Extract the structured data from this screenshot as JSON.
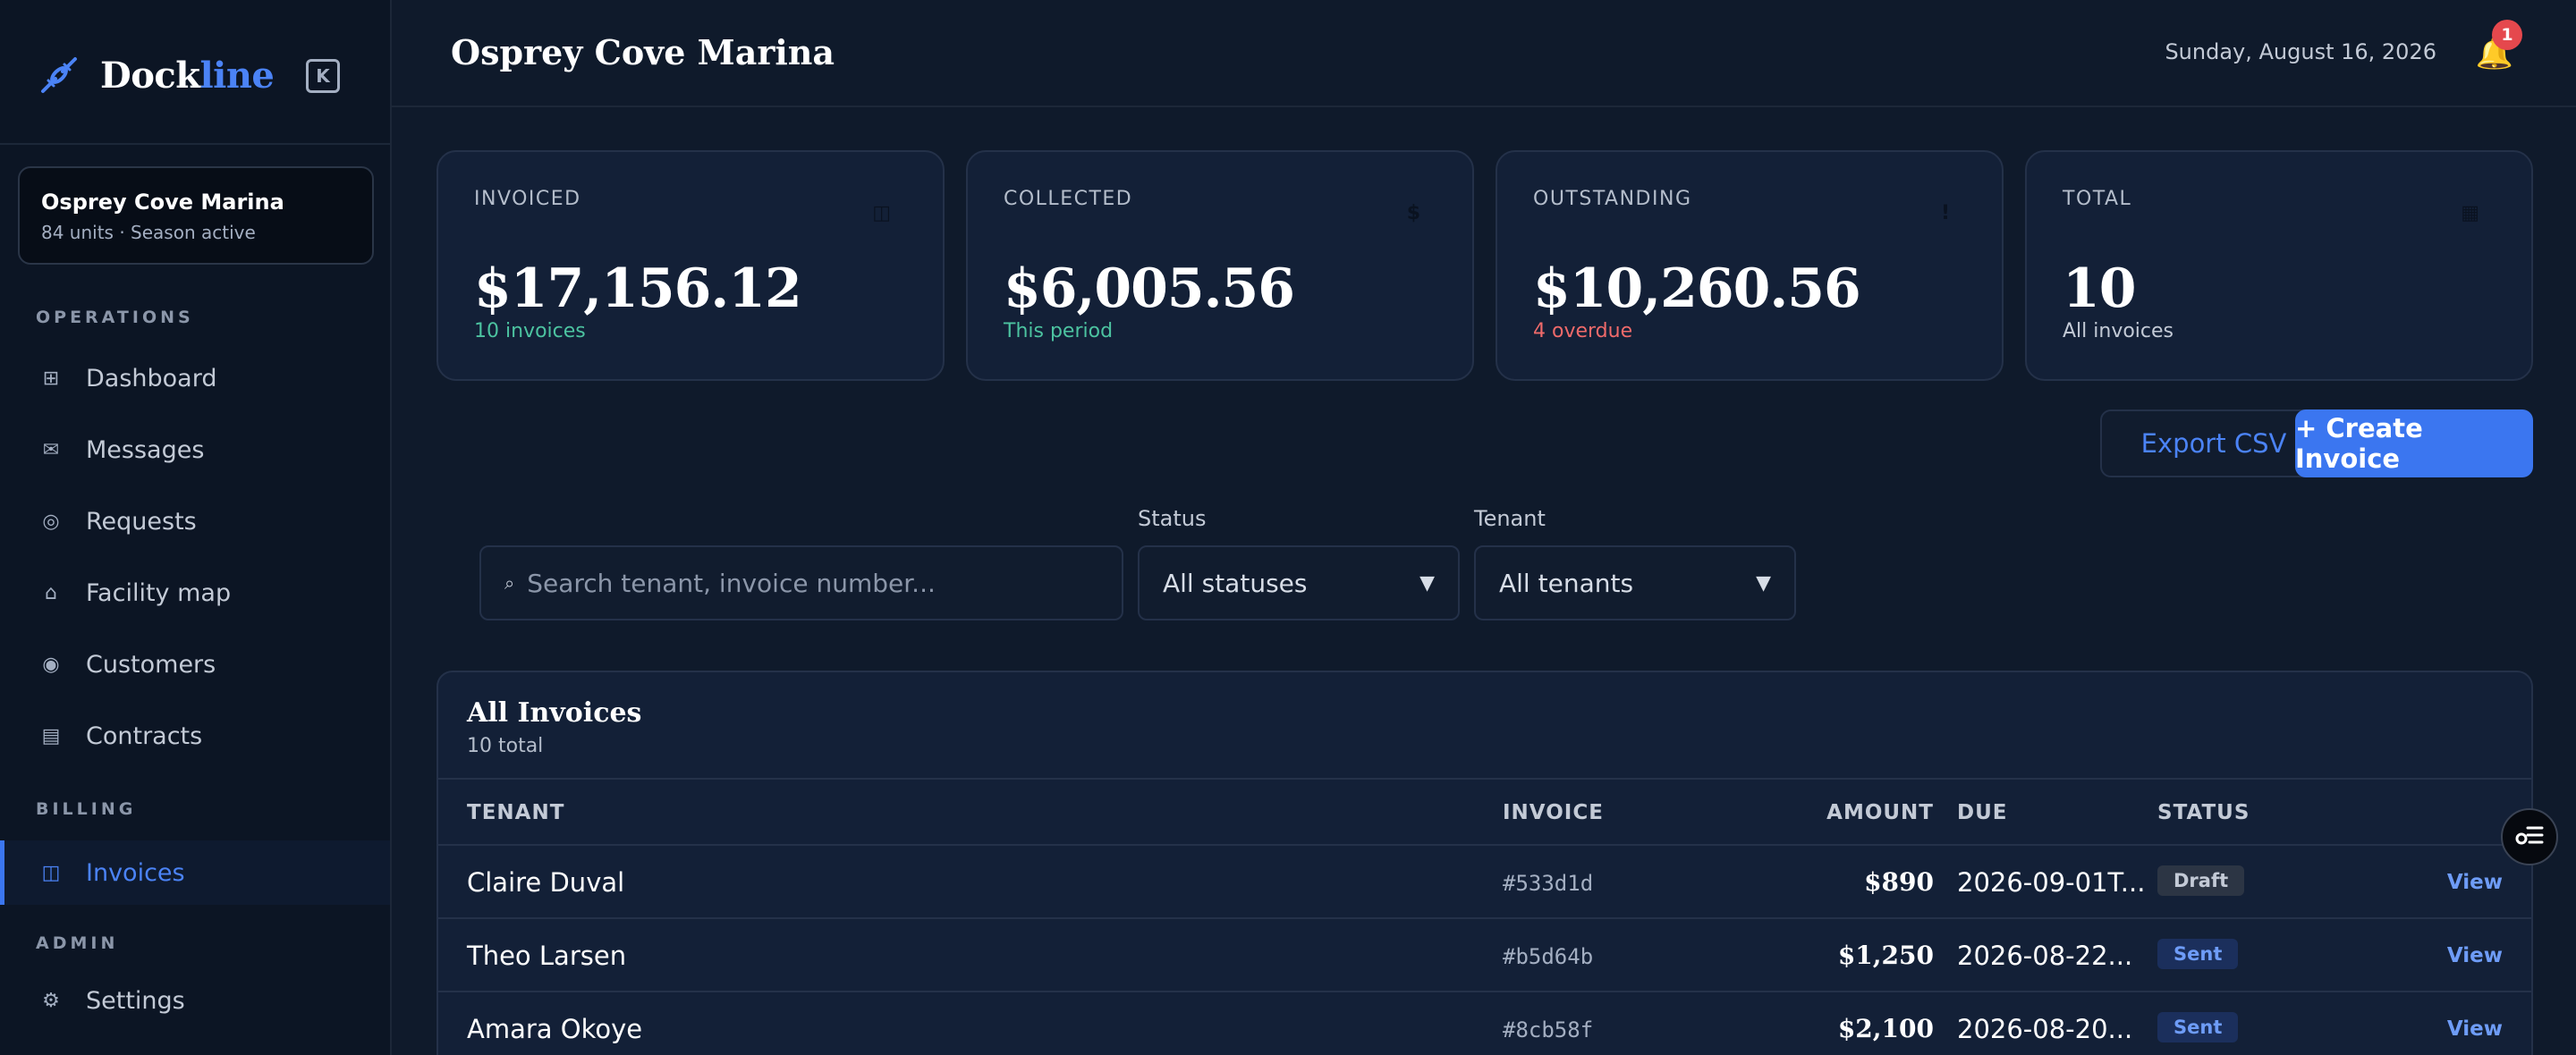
{
  "brand": {
    "name_main": "Dock",
    "name_accent": "line"
  },
  "org": {
    "name": "Osprey Cove Marina",
    "subtitle": "84 units · Season active"
  },
  "sidebar": {
    "sections": {
      "operations": "OPERATIONS",
      "billing": "BILLING",
      "admin": "ADMIN"
    },
    "items": [
      {
        "label": "Dashboard",
        "icon": "grid-icon",
        "glyph": "⊞"
      },
      {
        "label": "Messages",
        "icon": "mail-icon",
        "glyph": "✉"
      },
      {
        "label": "Requests",
        "icon": "target-icon",
        "glyph": "◎"
      },
      {
        "label": "Facility map",
        "icon": "home-icon",
        "glyph": "⌂"
      },
      {
        "label": "Customers",
        "icon": "user-circle-icon",
        "glyph": "◉"
      },
      {
        "label": "Contracts",
        "icon": "document-icon",
        "glyph": "▤"
      },
      {
        "label": "Invoices",
        "icon": "invoice-icon",
        "glyph": "◫"
      },
      {
        "label": "Settings",
        "icon": "gear-icon",
        "glyph": "⚙"
      }
    ]
  },
  "header": {
    "title": "Osprey Cove Marina",
    "date": "Sunday, August 16, 2026",
    "notifications": "1"
  },
  "stats": [
    {
      "label": "INVOICED",
      "value": "$17,156.12",
      "sub": "10 invoices",
      "icon_glyph": "◫"
    },
    {
      "label": "COLLECTED",
      "value": "$6,005.56",
      "sub": "This period",
      "icon_glyph": "$"
    },
    {
      "label": "OUTSTANDING",
      "value": "$10,260.56",
      "sub": "4 overdue",
      "icon_glyph": "!"
    },
    {
      "label": "TOTAL",
      "value": "10",
      "sub": "All invoices",
      "icon_glyph": "▦"
    }
  ],
  "actions": {
    "export": "Export CSV",
    "create": "+ Create Invoice"
  },
  "filters": {
    "search_placeholder": "Search tenant, invoice number...",
    "status_label": "Status",
    "status_value": "All statuses",
    "tenant_label": "Tenant",
    "tenant_value": "All tenants"
  },
  "table": {
    "title": "All Invoices",
    "subtitle": "10 total",
    "columns": [
      "TENANT",
      "INVOICE",
      "AMOUNT",
      "DUE",
      "STATUS"
    ],
    "view_label": "View",
    "rows": [
      {
        "tenant": "Claire Duval",
        "invoice": "#533d1d",
        "amount": "$890",
        "due": "2026-09-01T...",
        "status": "Draft"
      },
      {
        "tenant": "Theo Larsen",
        "invoice": "#b5d64b",
        "amount": "$1,250",
        "due": "2026-08-22...",
        "status": "Sent"
      },
      {
        "tenant": "Amara Okoye",
        "invoice": "#8cb58f",
        "amount": "$2,100",
        "due": "2026-08-20...",
        "status": "Sent"
      }
    ]
  },
  "colors": {
    "accent": "#3b76f0",
    "background": "#0f1a2b",
    "sidebar": "#0c1524",
    "positive": "#4cc3a0",
    "negative": "#ef6a6a"
  }
}
